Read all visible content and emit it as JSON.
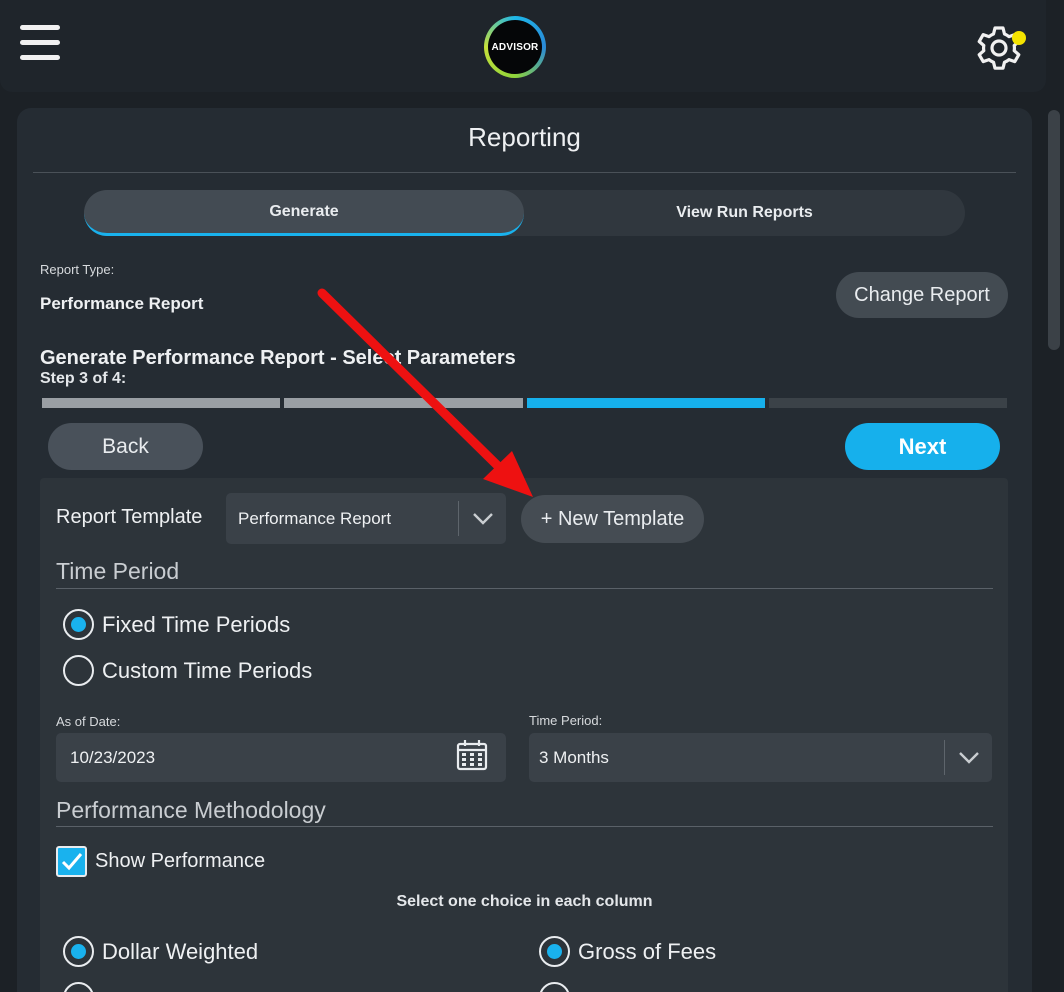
{
  "app": {
    "logo_text": "ADVISOR",
    "icons": {
      "menu": "hamburger-icon",
      "settings": "gear-icon",
      "notification": "notification-dot"
    },
    "accent_color": "#16b0ec",
    "notification_color": "#f4e300"
  },
  "page": {
    "title": "Reporting"
  },
  "tabs": [
    {
      "label": "Generate",
      "active": true
    },
    {
      "label": "View Run Reports",
      "active": false
    }
  ],
  "report": {
    "type_label": "Report Type:",
    "type_value": "Performance Report",
    "change_button": "Change Report"
  },
  "wizard": {
    "title": "Generate Performance Report - Select Parameters",
    "step_text": "Step 3 of 4:",
    "current_step": 3,
    "total_steps": 4,
    "back_label": "Back",
    "next_label": "Next"
  },
  "template": {
    "label": "Report Template",
    "selected": "Performance Report",
    "new_button": "+ New Template"
  },
  "time_period": {
    "section_title": "Time Period",
    "options": [
      {
        "label": "Fixed Time Periods",
        "selected": true
      },
      {
        "label": "Custom Time Periods",
        "selected": false
      }
    ],
    "as_of_label": "As of Date:",
    "as_of_value": "10/23/2023",
    "period_label": "Time Period:",
    "period_value": "3 Months"
  },
  "methodology": {
    "section_title": "Performance Methodology",
    "show_performance_label": "Show Performance",
    "show_performance_checked": true,
    "hint": "Select one choice in each column",
    "left_column": [
      {
        "label": "Dollar Weighted",
        "selected": true
      }
    ],
    "right_column": [
      {
        "label": "Gross of Fees",
        "selected": true
      }
    ]
  },
  "annotation": {
    "arrow_color": "#ee1111"
  }
}
